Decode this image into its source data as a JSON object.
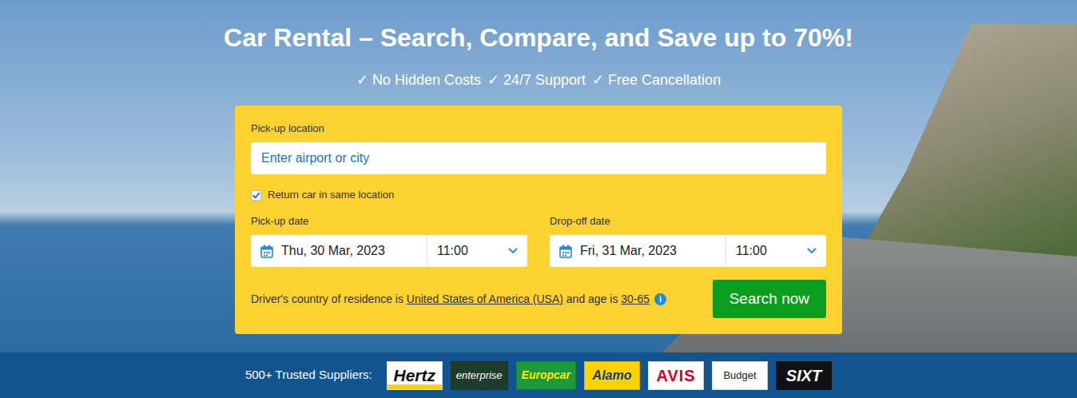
{
  "hero": {
    "title": "Car Rental – Search, Compare, and Save up to 70%!",
    "benefits": [
      {
        "check": "✓",
        "label": "No Hidden Costs"
      },
      {
        "check": "✓",
        "label": "24/7 Support"
      },
      {
        "check": "✓",
        "label": "Free Cancellation"
      }
    ]
  },
  "search": {
    "pickup_label": "Pick-up location",
    "pickup_placeholder": "Enter airport or city",
    "same_location": {
      "label": "Return car in same location",
      "checked": true
    },
    "pickup": {
      "label": "Pick-up date",
      "date": "Thu, 30 Mar, 2023",
      "time": "11:00"
    },
    "dropoff": {
      "label": "Drop-off date",
      "date": "Fri, 31 Mar, 2023",
      "time": "11:00"
    },
    "residence": {
      "prefix": "Driver's country of residence is",
      "country": "United States of America (USA)",
      "middle": "and age is",
      "age": "30-65",
      "info_icon": "i"
    },
    "button": "Search now"
  },
  "suppliers": {
    "label": "500+ Trusted Suppliers:",
    "logos": [
      {
        "name": "Hertz",
        "color": "#ffffff"
      },
      {
        "name": "enterprise",
        "color": "#1f3b2a"
      },
      {
        "name": "Europcar",
        "color": "#1a9a3a"
      },
      {
        "name": "Alamo",
        "color": "#ffd200"
      },
      {
        "name": "AVIS",
        "color": "#ffffff"
      },
      {
        "name": "Budget",
        "color": "#ffffff"
      },
      {
        "name": "SIXT",
        "color": "#111111"
      }
    ]
  }
}
